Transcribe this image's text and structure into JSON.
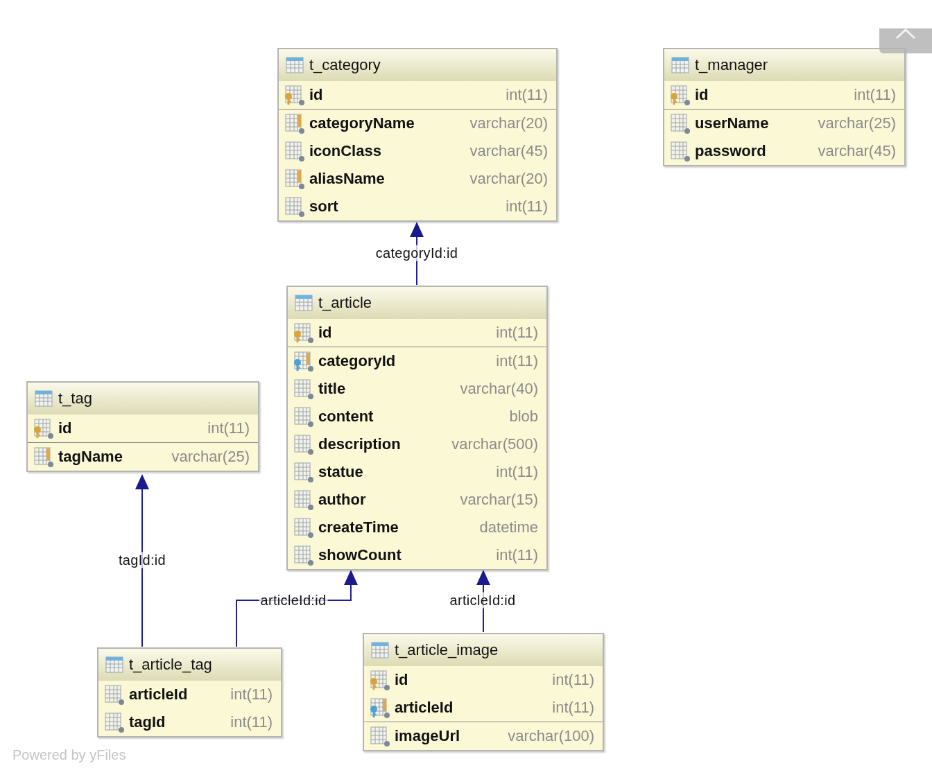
{
  "tables": [
    {
      "name": "t_category",
      "key_columns": [
        {
          "name": "id",
          "type": "int(11)",
          "kind": "primary"
        }
      ],
      "columns": [
        {
          "name": "categoryName",
          "type": "varchar(20)",
          "kind": "indexed"
        },
        {
          "name": "iconClass",
          "type": "varchar(45)",
          "kind": "plain"
        },
        {
          "name": "aliasName",
          "type": "varchar(20)",
          "kind": "indexed"
        },
        {
          "name": "sort",
          "type": "int(11)",
          "kind": "plain"
        }
      ]
    },
    {
      "name": "t_manager",
      "key_columns": [
        {
          "name": "id",
          "type": "int(11)",
          "kind": "primary"
        }
      ],
      "columns": [
        {
          "name": "userName",
          "type": "varchar(25)",
          "kind": "plain"
        },
        {
          "name": "password",
          "type": "varchar(45)",
          "kind": "plain"
        }
      ]
    },
    {
      "name": "t_tag",
      "key_columns": [
        {
          "name": "id",
          "type": "int(11)",
          "kind": "primary"
        }
      ],
      "columns": [
        {
          "name": "tagName",
          "type": "varchar(25)",
          "kind": "indexed"
        }
      ]
    },
    {
      "name": "t_article",
      "key_columns": [
        {
          "name": "id",
          "type": "int(11)",
          "kind": "primary"
        }
      ],
      "columns": [
        {
          "name": "categoryId",
          "type": "int(11)",
          "kind": "foreign"
        },
        {
          "name": "title",
          "type": "varchar(40)",
          "kind": "plain"
        },
        {
          "name": "content",
          "type": "blob",
          "kind": "plain"
        },
        {
          "name": "description",
          "type": "varchar(500)",
          "kind": "plain"
        },
        {
          "name": "statue",
          "type": "int(11)",
          "kind": "plain"
        },
        {
          "name": "author",
          "type": "varchar(15)",
          "kind": "plain"
        },
        {
          "name": "createTime",
          "type": "datetime",
          "kind": "plain"
        },
        {
          "name": "showCount",
          "type": "int(11)",
          "kind": "plain"
        }
      ]
    },
    {
      "name": "t_article_tag",
      "columns": [
        {
          "name": "articleId",
          "type": "int(11)",
          "kind": "plain"
        },
        {
          "name": "tagId",
          "type": "int(11)",
          "kind": "plain"
        }
      ]
    },
    {
      "name": "t_article_image",
      "key_columns": [
        {
          "name": "id",
          "type": "int(11)",
          "kind": "primary"
        },
        {
          "name": "articleId",
          "type": "int(11)",
          "kind": "foreign"
        }
      ],
      "columns": [
        {
          "name": "imageUrl",
          "type": "varchar(100)",
          "kind": "plain"
        }
      ]
    }
  ],
  "relations": [
    {
      "label": "categoryId:id"
    },
    {
      "label": "tagId:id"
    },
    {
      "label": "articleId:id"
    },
    {
      "label": "articleId:id"
    }
  ],
  "footer": "Powered by yFiles"
}
